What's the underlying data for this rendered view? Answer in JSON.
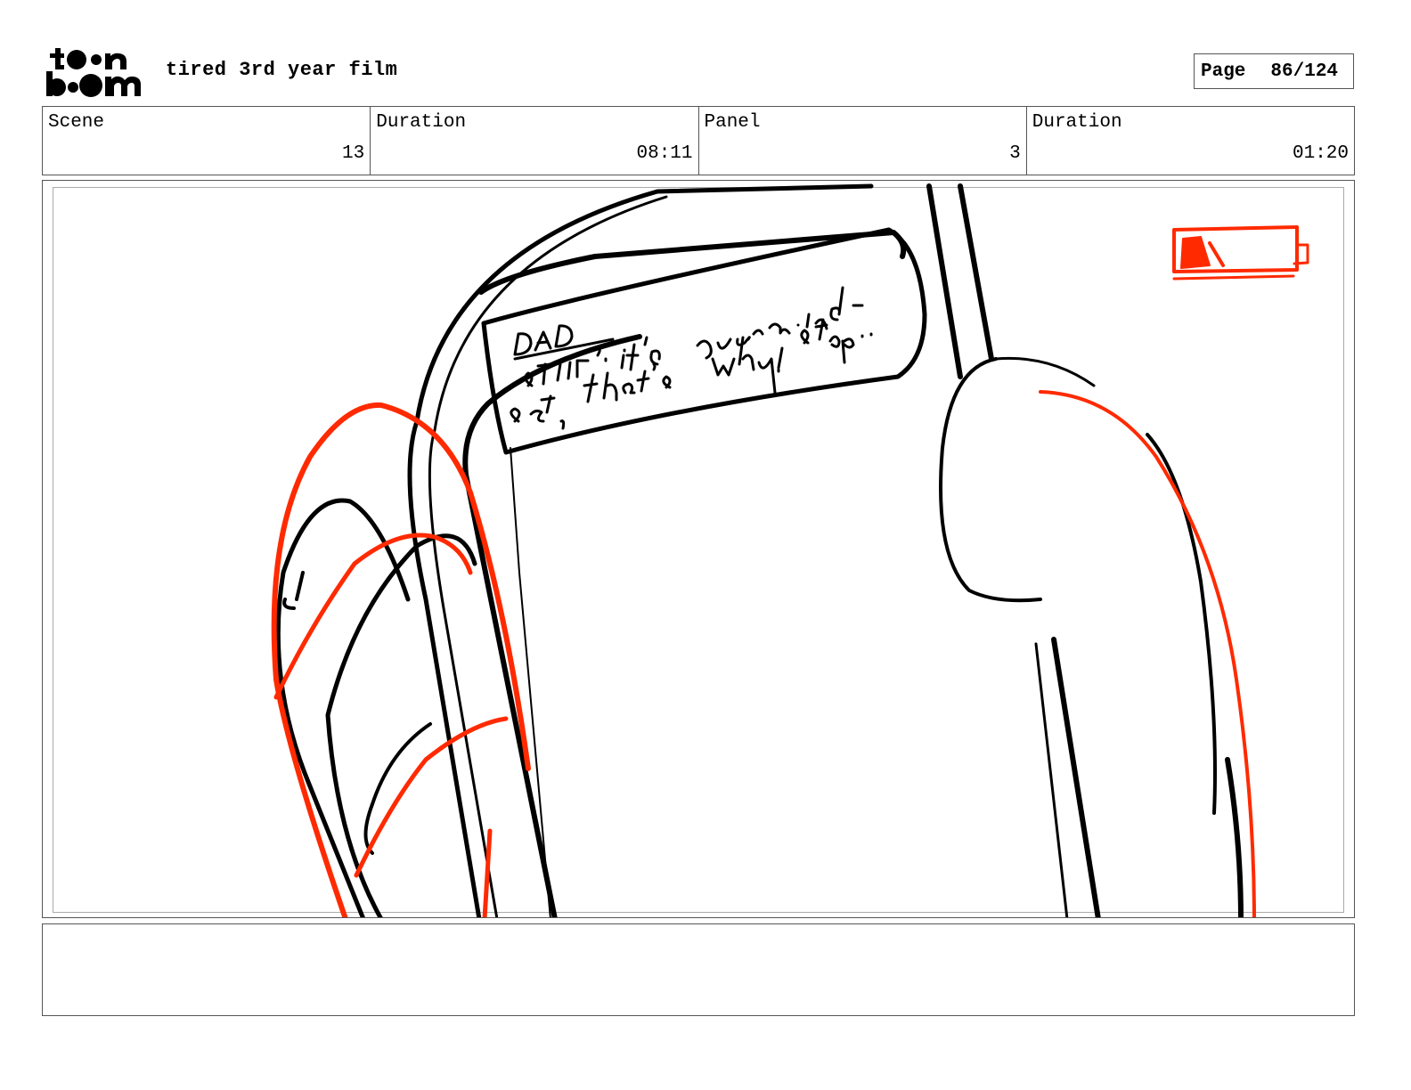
{
  "header": {
    "logo_text": [
      "toon",
      "boom"
    ],
    "project_title": "tired 3rd year film",
    "page_label": "Page",
    "page_value": "86/124"
  },
  "info": {
    "scene_label": "Scene",
    "scene_value": "13",
    "scene_duration_label": "Duration",
    "scene_duration_value": "08:11",
    "panel_label": "Panel",
    "panel_value": "3",
    "panel_duration_label": "Duration",
    "panel_duration_value": "01:20"
  },
  "panel": {
    "sketch_text_lines": [
      "DAD",
      "STILL? it's your mind-",
      "set, that's why! stop.."
    ],
    "colors": {
      "ink": "#000000",
      "red": "#ff2a00"
    },
    "icons": [
      "battery-low-icon"
    ]
  },
  "notes": {
    "text": ""
  }
}
